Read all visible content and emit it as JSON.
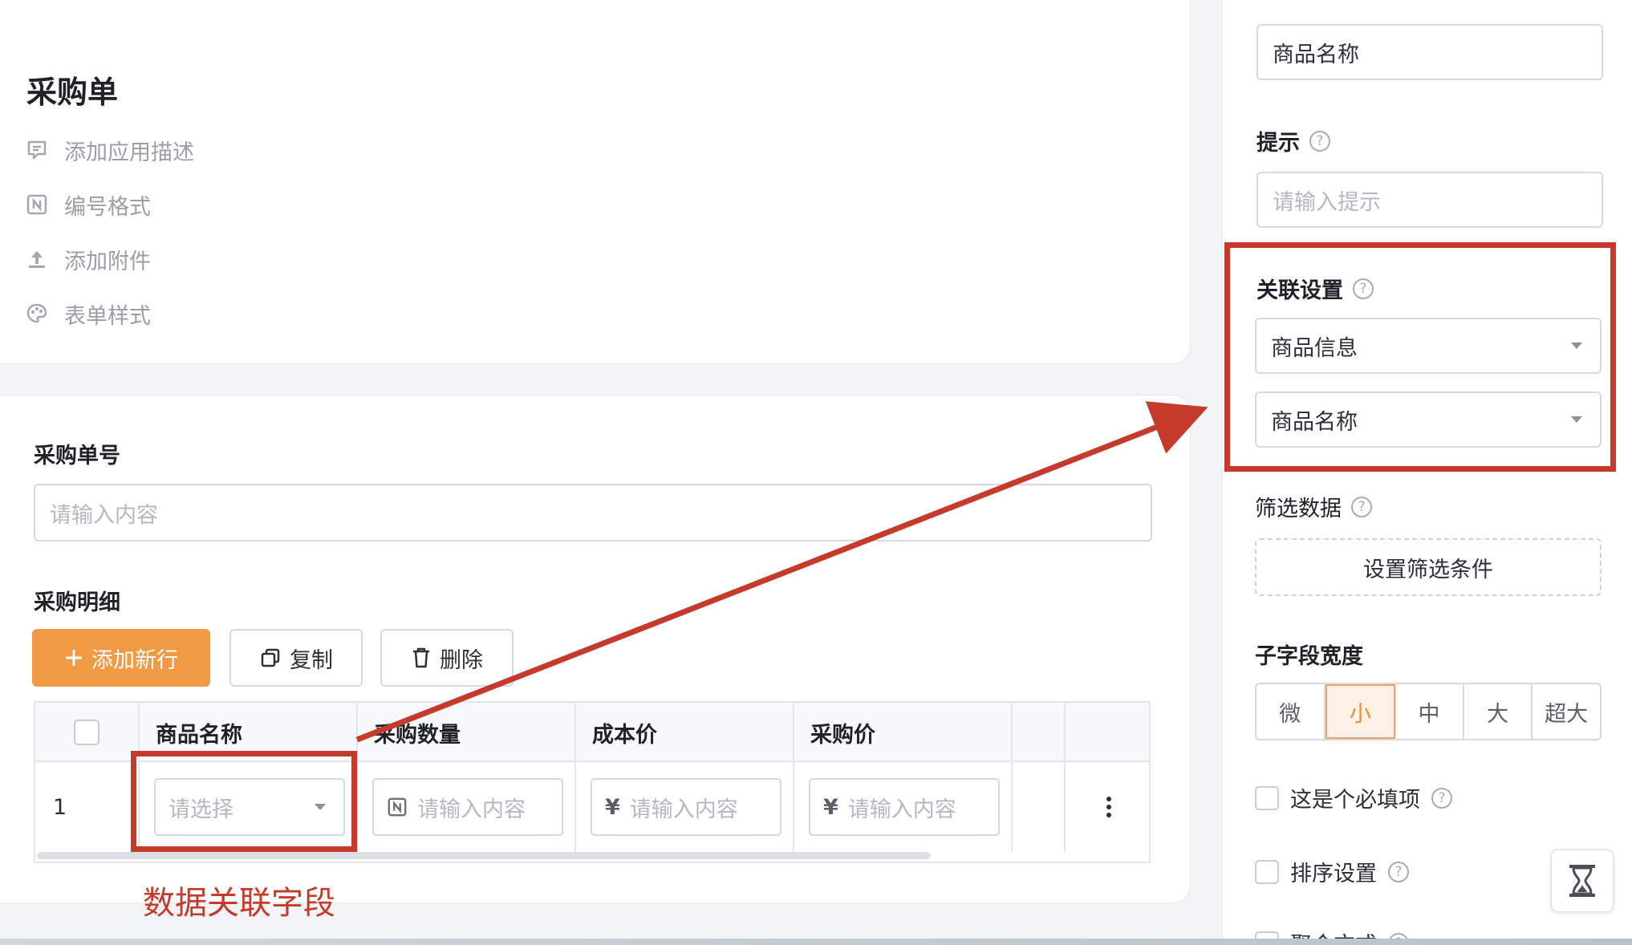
{
  "app": {
    "title": "采购单",
    "meta": [
      {
        "label": "添加应用描述",
        "icon": "comment-icon"
      },
      {
        "label": "编号格式",
        "icon": "number-format-icon"
      },
      {
        "label": "添加附件",
        "icon": "upload-icon"
      },
      {
        "label": "表单样式",
        "icon": "palette-icon"
      }
    ]
  },
  "form": {
    "order_no_label": "采购单号",
    "order_no_placeholder": "请输入内容",
    "detail_label": "采购明细",
    "toolbar": {
      "add": "添加新行",
      "copy": "复制",
      "delete": "删除"
    },
    "table": {
      "columns": [
        "商品名称",
        "采购数量",
        "成本价",
        "采购价"
      ],
      "rows": [
        {
          "index": "1",
          "product_placeholder": "请选择",
          "qty_placeholder": "请输入内容",
          "cost_prefix": "¥",
          "cost_placeholder": "请输入内容",
          "price_prefix": "¥",
          "price_placeholder": "请输入内容"
        }
      ]
    }
  },
  "panel": {
    "title_value": "商品名称",
    "hint_label": "提示",
    "hint_placeholder": "请输入提示",
    "relation_label": "关联设置",
    "relation_source": "商品信息",
    "relation_field": "商品名称",
    "filter_label": "筛选数据",
    "filter_button": "设置筛选条件",
    "width_label": "子字段宽度",
    "width_options": [
      "微",
      "小",
      "中",
      "大",
      "超大"
    ],
    "width_selected": "小",
    "required_label": "这是个必填项",
    "sort_label": "排序设置",
    "aggregate_label": "聚合方式"
  },
  "annotation": {
    "label": "数据关联字段",
    "color": "#c63a2b"
  },
  "colors": {
    "accent": "#f19a45",
    "selected_bg": "#fff1e6",
    "selected_text": "#f08a2f"
  }
}
